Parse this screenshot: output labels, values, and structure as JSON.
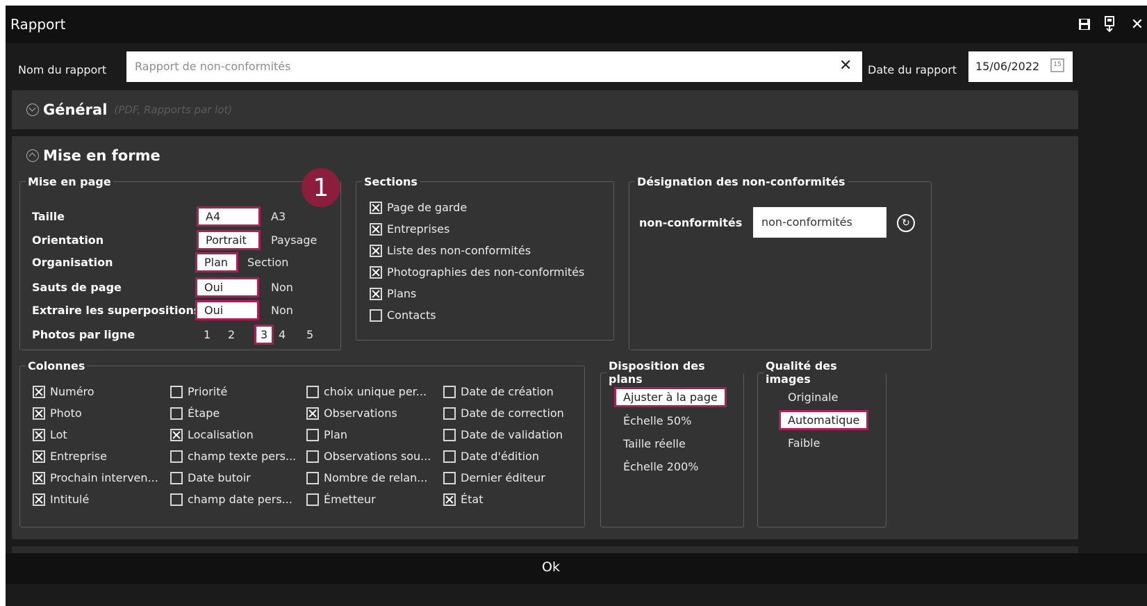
{
  "window": {
    "title": "Rapport"
  },
  "titlebar_icons": {
    "save": "floppy-disk-icon",
    "export": "export-icon",
    "close": "close-icon"
  },
  "header": {
    "name_label": "Nom du rapport",
    "name_value": "Rapport de non-conformités",
    "clear": "✕",
    "date_label": "Date du rapport",
    "date_value": "15/06/2022",
    "calendar": "15"
  },
  "general": {
    "title": "Général",
    "hint": "(PDF, Rapports par lot)"
  },
  "mise": {
    "title": "Mise en forme",
    "page": {
      "legend": "Mise en page",
      "rows": [
        {
          "label": "Taille",
          "options": [
            "A4",
            "A3"
          ],
          "selected": 0
        },
        {
          "label": "Orientation",
          "options": [
            "Portrait",
            "Paysage"
          ],
          "selected": 0
        },
        {
          "label": "Organisation",
          "options": [
            "Plan",
            "Section"
          ],
          "selected": 0
        },
        {
          "label": "Sauts de page",
          "options": [
            "Oui",
            "Non"
          ],
          "selected": 0
        },
        {
          "label": "Extraire les superpositions",
          "options": [
            "Oui",
            "Non"
          ],
          "selected": 0
        },
        {
          "label": "Photos par ligne",
          "options": [
            "1",
            "2",
            "3",
            "4",
            "5"
          ],
          "selected": 2
        }
      ]
    },
    "badge": "1",
    "sections": {
      "legend": "Sections",
      "items": [
        {
          "label": "Page de garde",
          "checked": true
        },
        {
          "label": "Entreprises",
          "checked": true
        },
        {
          "label": "Liste des non-conformités",
          "checked": true
        },
        {
          "label": "Photographies des non-conformités",
          "checked": true
        },
        {
          "label": "Plans",
          "checked": true
        },
        {
          "label": "Contacts",
          "checked": false
        }
      ]
    },
    "designation": {
      "legend": "Désignation des non-conformités",
      "label": "non-conformités",
      "value": "non-conformités",
      "reset": "↻"
    },
    "columns": {
      "legend": "Colonnes",
      "cols": [
        [
          {
            "label": "Numéro",
            "checked": true
          },
          {
            "label": "Photo",
            "checked": true
          },
          {
            "label": "Lot",
            "checked": true
          },
          {
            "label": "Entreprise",
            "checked": true
          },
          {
            "label": "Prochain interven...",
            "checked": true
          },
          {
            "label": "Intitulé",
            "checked": true
          }
        ],
        [
          {
            "label": "Priorité",
            "checked": false
          },
          {
            "label": "Étape",
            "checked": false
          },
          {
            "label": "Localisation",
            "checked": true
          },
          {
            "label": "champ texte pers...",
            "checked": false
          },
          {
            "label": "Date butoir",
            "checked": false
          },
          {
            "label": "champ date pers...",
            "checked": false
          }
        ],
        [
          {
            "label": "choix unique per...",
            "checked": false
          },
          {
            "label": "Observations",
            "checked": true
          },
          {
            "label": "Plan",
            "checked": false
          },
          {
            "label": "Observations sou...",
            "checked": false
          },
          {
            "label": "Nombre de relan...",
            "checked": false
          },
          {
            "label": "Émetteur",
            "checked": false
          }
        ],
        [
          {
            "label": "Date de création",
            "checked": false
          },
          {
            "label": "Date de correction",
            "checked": false
          },
          {
            "label": "Date de validation",
            "checked": false
          },
          {
            "label": "Date d'édition",
            "checked": false
          },
          {
            "label": "Dernier éditeur",
            "checked": false
          },
          {
            "label": "État",
            "checked": true
          }
        ]
      ]
    },
    "plans": {
      "legend": "Disposition des plans",
      "options": [
        "Ajuster à la page",
        "Échelle 50%",
        "Taille réelle",
        "Échelle 200%"
      ],
      "selected": 0
    },
    "quality": {
      "legend": "Qualité des images",
      "options": [
        "Originale",
        "Automatique",
        "Faible"
      ],
      "selected": 1
    }
  },
  "footer": {
    "ok": "Ok"
  },
  "colors": {
    "accent": "#b11d56",
    "badge": "#8b1e3c",
    "panel": "#333333",
    "background": "#1b1b1b"
  }
}
